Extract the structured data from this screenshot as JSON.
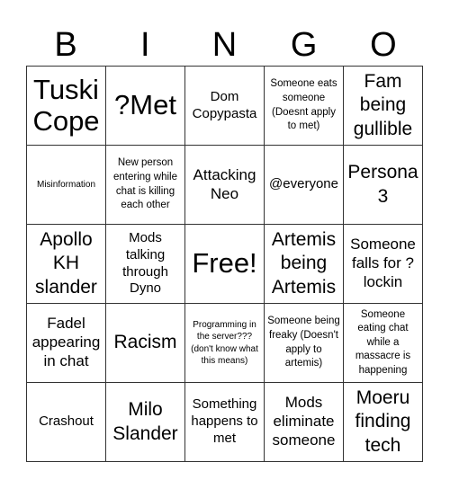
{
  "header": {
    "letters": [
      "B",
      "I",
      "N",
      "G",
      "O"
    ]
  },
  "cells": [
    [
      "Tuski Cope",
      "?Met",
      "Dom Copypasta",
      "Someone eats someone (Doesnt apply to met)",
      "Fam being gullible"
    ],
    [
      "Misinformation",
      "New person entering while chat is killing each other",
      "Attacking Neo",
      "@everyone",
      "Persona 3"
    ],
    [
      "Apollo KH slander",
      "Mods talking through Dyno",
      "Free!",
      "Artemis being Artemis",
      "Someone falls for ?lockin"
    ],
    [
      "Fadel appearing in chat",
      "Racism",
      "Programming in the server??? (don't know what this means)",
      "Someone being freaky (Doesn't apply to artemis)",
      "Someone eating chat while a massacre is happening"
    ],
    [
      "Crashout",
      "Milo Slander",
      "Something happens to met",
      "Mods eliminate someone",
      "Moeru finding tech"
    ]
  ]
}
